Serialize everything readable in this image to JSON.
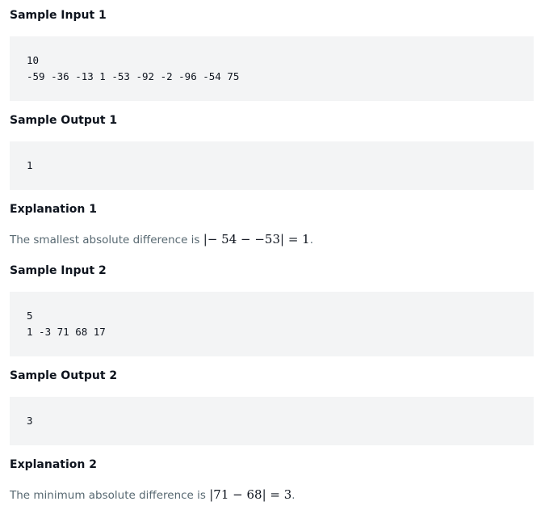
{
  "sections": {
    "sample_input_1": {
      "heading": "Sample Input 1",
      "lines": [
        "10",
        "-59 -36 -13 1 -53 -92 -2 -96 -54 75"
      ]
    },
    "sample_output_1": {
      "heading": "Sample Output 1",
      "lines": [
        "1"
      ]
    },
    "explanation_1": {
      "heading": "Explanation 1",
      "text": "The smallest absolute difference is ",
      "math": "|− 54 − −53| = 1",
      "end": "."
    },
    "sample_input_2": {
      "heading": "Sample Input 2",
      "lines": [
        "5",
        "1 -3 71 68 17"
      ]
    },
    "sample_output_2": {
      "heading": "Sample Output 2",
      "lines": [
        "3"
      ]
    },
    "explanation_2": {
      "heading": "Explanation 2",
      "text": "The minimum absolute difference is ",
      "math": "|71 − 68| = 3",
      "end": "."
    }
  }
}
